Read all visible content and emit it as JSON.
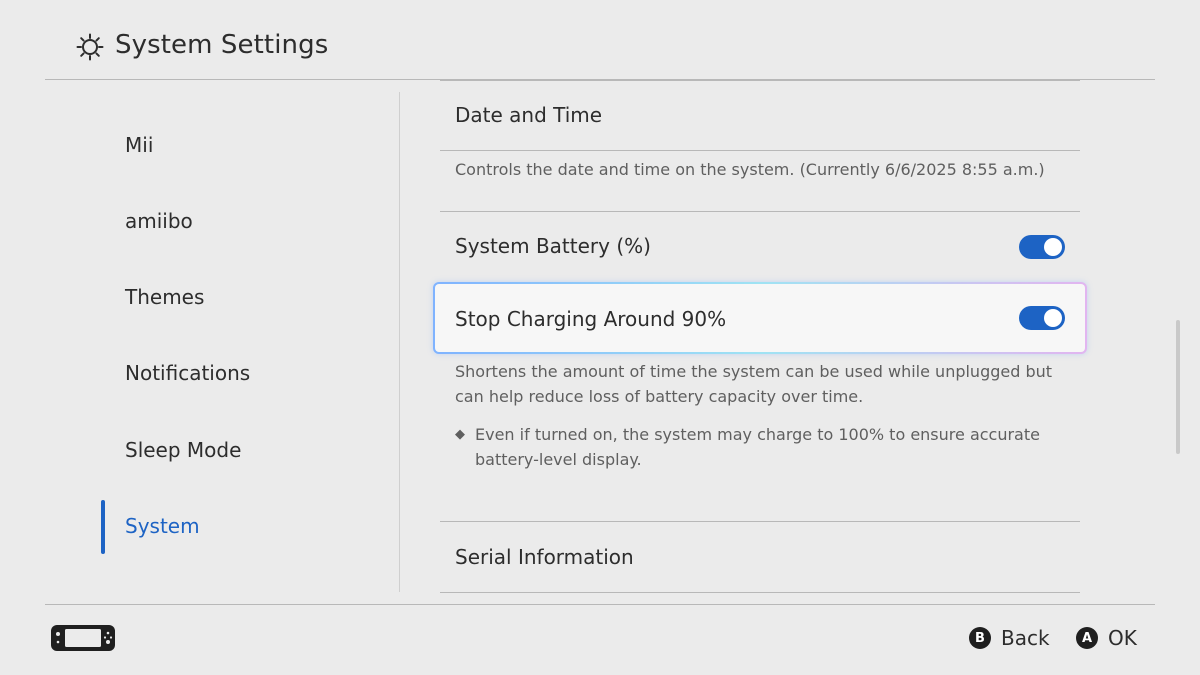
{
  "header": {
    "title": "System Settings",
    "icon": "gear-icon"
  },
  "sidebar": {
    "items": [
      {
        "label": "Mii"
      },
      {
        "label": "amiibo"
      },
      {
        "label": "Themes"
      },
      {
        "label": "Notifications"
      },
      {
        "label": "Sleep Mode"
      },
      {
        "label": "System",
        "active": true
      }
    ]
  },
  "main": {
    "date_time": {
      "label": "Date and Time",
      "description": "Controls the date and time on the system. (Currently 6/6/2025 8:55 a.m.)"
    },
    "system_battery": {
      "label": "System Battery (%)",
      "enabled": true
    },
    "stop_charging": {
      "label": "Stop Charging Around 90%",
      "enabled": true,
      "description": "Shortens the amount of time the system can be used while unplugged but can help reduce loss of battery capacity over time.",
      "note_bullet": "◆",
      "note": "Even if turned on, the system may charge to 100% to ensure accurate battery-level display."
    },
    "serial_info": {
      "label": "Serial Information"
    }
  },
  "footer": {
    "console_icon": "handheld-console-icon",
    "back": {
      "glyph": "B",
      "label": "Back"
    },
    "ok": {
      "glyph": "A",
      "label": "OK"
    }
  },
  "colors": {
    "accent": "#1d63c4",
    "background": "#ebebeb",
    "text": "#2d2d2d",
    "muted_text": "#5f5f5f"
  }
}
